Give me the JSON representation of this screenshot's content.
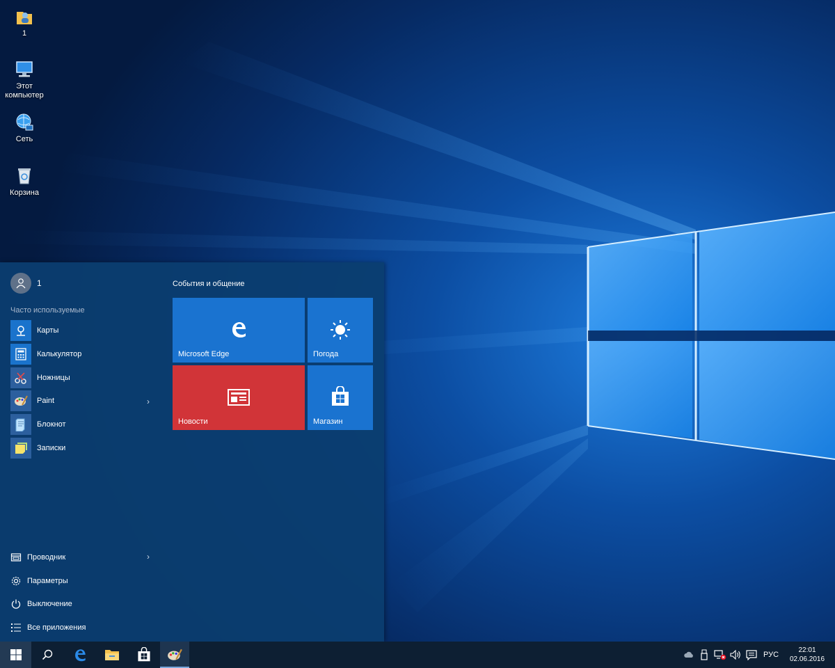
{
  "desktop": {
    "icons": [
      {
        "label": "1",
        "icon": "user-folder-icon"
      },
      {
        "label": "Этот компьютер",
        "icon": "computer-icon"
      },
      {
        "label": "Сеть",
        "icon": "network-icon"
      },
      {
        "label": "Корзина",
        "icon": "recycle-bin-icon"
      }
    ]
  },
  "start_menu": {
    "user_name": "1",
    "most_used_label": "Часто используемые",
    "apps": [
      {
        "label": "Карты",
        "icon": "maps-icon",
        "has_submenu": false
      },
      {
        "label": "Калькулятор",
        "icon": "calculator-icon",
        "has_submenu": false
      },
      {
        "label": "Ножницы",
        "icon": "scissors-icon",
        "has_submenu": false
      },
      {
        "label": "Paint",
        "icon": "paint-icon",
        "has_submenu": true
      },
      {
        "label": "Блокнот",
        "icon": "notepad-icon",
        "has_submenu": false
      },
      {
        "label": "Записки",
        "icon": "sticky-notes-icon",
        "has_submenu": false
      }
    ],
    "bottom_items": [
      {
        "label": "Проводник",
        "icon": "file-explorer-icon",
        "has_submenu": true
      },
      {
        "label": "Параметры",
        "icon": "gear-icon",
        "has_submenu": false
      },
      {
        "label": "Выключение",
        "icon": "power-icon",
        "has_submenu": false
      },
      {
        "label": "Все приложения",
        "icon": "all-apps-icon",
        "has_submenu": false
      }
    ],
    "tile_group_title": "События и общение",
    "tiles": [
      {
        "label": "Microsoft Edge",
        "icon": "edge-icon",
        "color": "#1a73d0"
      },
      {
        "label": "Погода",
        "icon": "sun-icon",
        "color": "#1a73d0"
      },
      {
        "label": "Новости",
        "icon": "news-icon",
        "color": "#d13438"
      },
      {
        "label": "Магазин",
        "icon": "store-icon",
        "color": "#1a73d0"
      }
    ]
  },
  "taskbar": {
    "pinned": [
      "windows-start-icon",
      "search-icon",
      "edge-icon",
      "file-explorer-icon",
      "store-icon",
      "paint-icon"
    ],
    "tray": {
      "language": "РУС",
      "time": "22:01",
      "date": "02.06.2016",
      "icons": [
        "onedrive-cloud-icon",
        "usb-drive-icon",
        "network-disconnected-icon",
        "volume-icon",
        "action-center-icon"
      ]
    }
  },
  "colors": {
    "accent": "#1a73d0",
    "news_tile": "#d13438",
    "start_menu_bg": "#0b3e70",
    "taskbar_bg": "#0d1f33"
  }
}
